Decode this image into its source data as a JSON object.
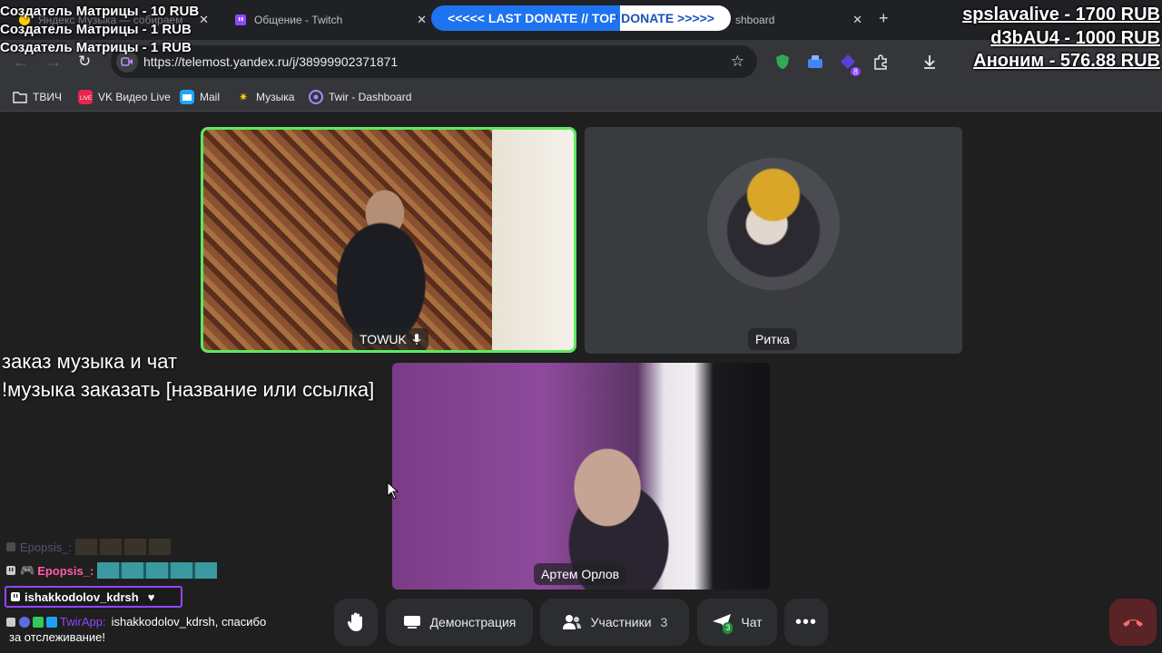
{
  "browser": {
    "tabs": [
      {
        "title": "Яндекс Музыка — собираем"
      },
      {
        "title": "Общение - Twitch"
      },
      {
        "title": "shboard"
      }
    ],
    "new_tab_label": "+",
    "address": "https://telemost.yandex.ru/j/38999902371871",
    "extension_badge": "8",
    "bookmarks": [
      {
        "label": "ТВИЧ"
      },
      {
        "label": "VK Видео Live"
      },
      {
        "label": "Mail"
      },
      {
        "label": "Музыка"
      },
      {
        "label": "Twir - Dashboard"
      }
    ]
  },
  "call": {
    "participants": [
      {
        "name": "TOWUK",
        "active_speaker": true
      },
      {
        "name": "Ритка"
      },
      {
        "name": "Артем Орлов"
      }
    ],
    "controls": {
      "demo_label": "Демонстрация",
      "participants_label": "Участники",
      "participants_count": "3",
      "chat_label": "Чат",
      "chat_badge": "3"
    },
    "accent_color": "#5ee85e"
  },
  "overlay": {
    "donations_left": [
      "Создатель Матрицы - 10 RUB",
      "Создатель Матрицы - 1 RUB",
      "Создатель Матрицы - 1 RUB"
    ],
    "donations_right": [
      "spslavalive - 1700 RUB",
      "d3bAU4 - 1000 RUB",
      "Аноним - 576.88 RUB"
    ],
    "ticker": "<<<<< LAST DONATE // TOP DONATE >>>>>",
    "commands": [
      "заказ музыка и чат",
      "!музыка заказать [название или ссылка]"
    ],
    "chat": {
      "faded_user": "Epopsis_:",
      "user": "Epopsis_:",
      "follower": "ishakkodolov_kdrsh",
      "bot_name": "TwirApp:",
      "message_line1": "ishakkodolov_kdrsh, спасибо",
      "message_line2": "за отслеживание!"
    }
  }
}
